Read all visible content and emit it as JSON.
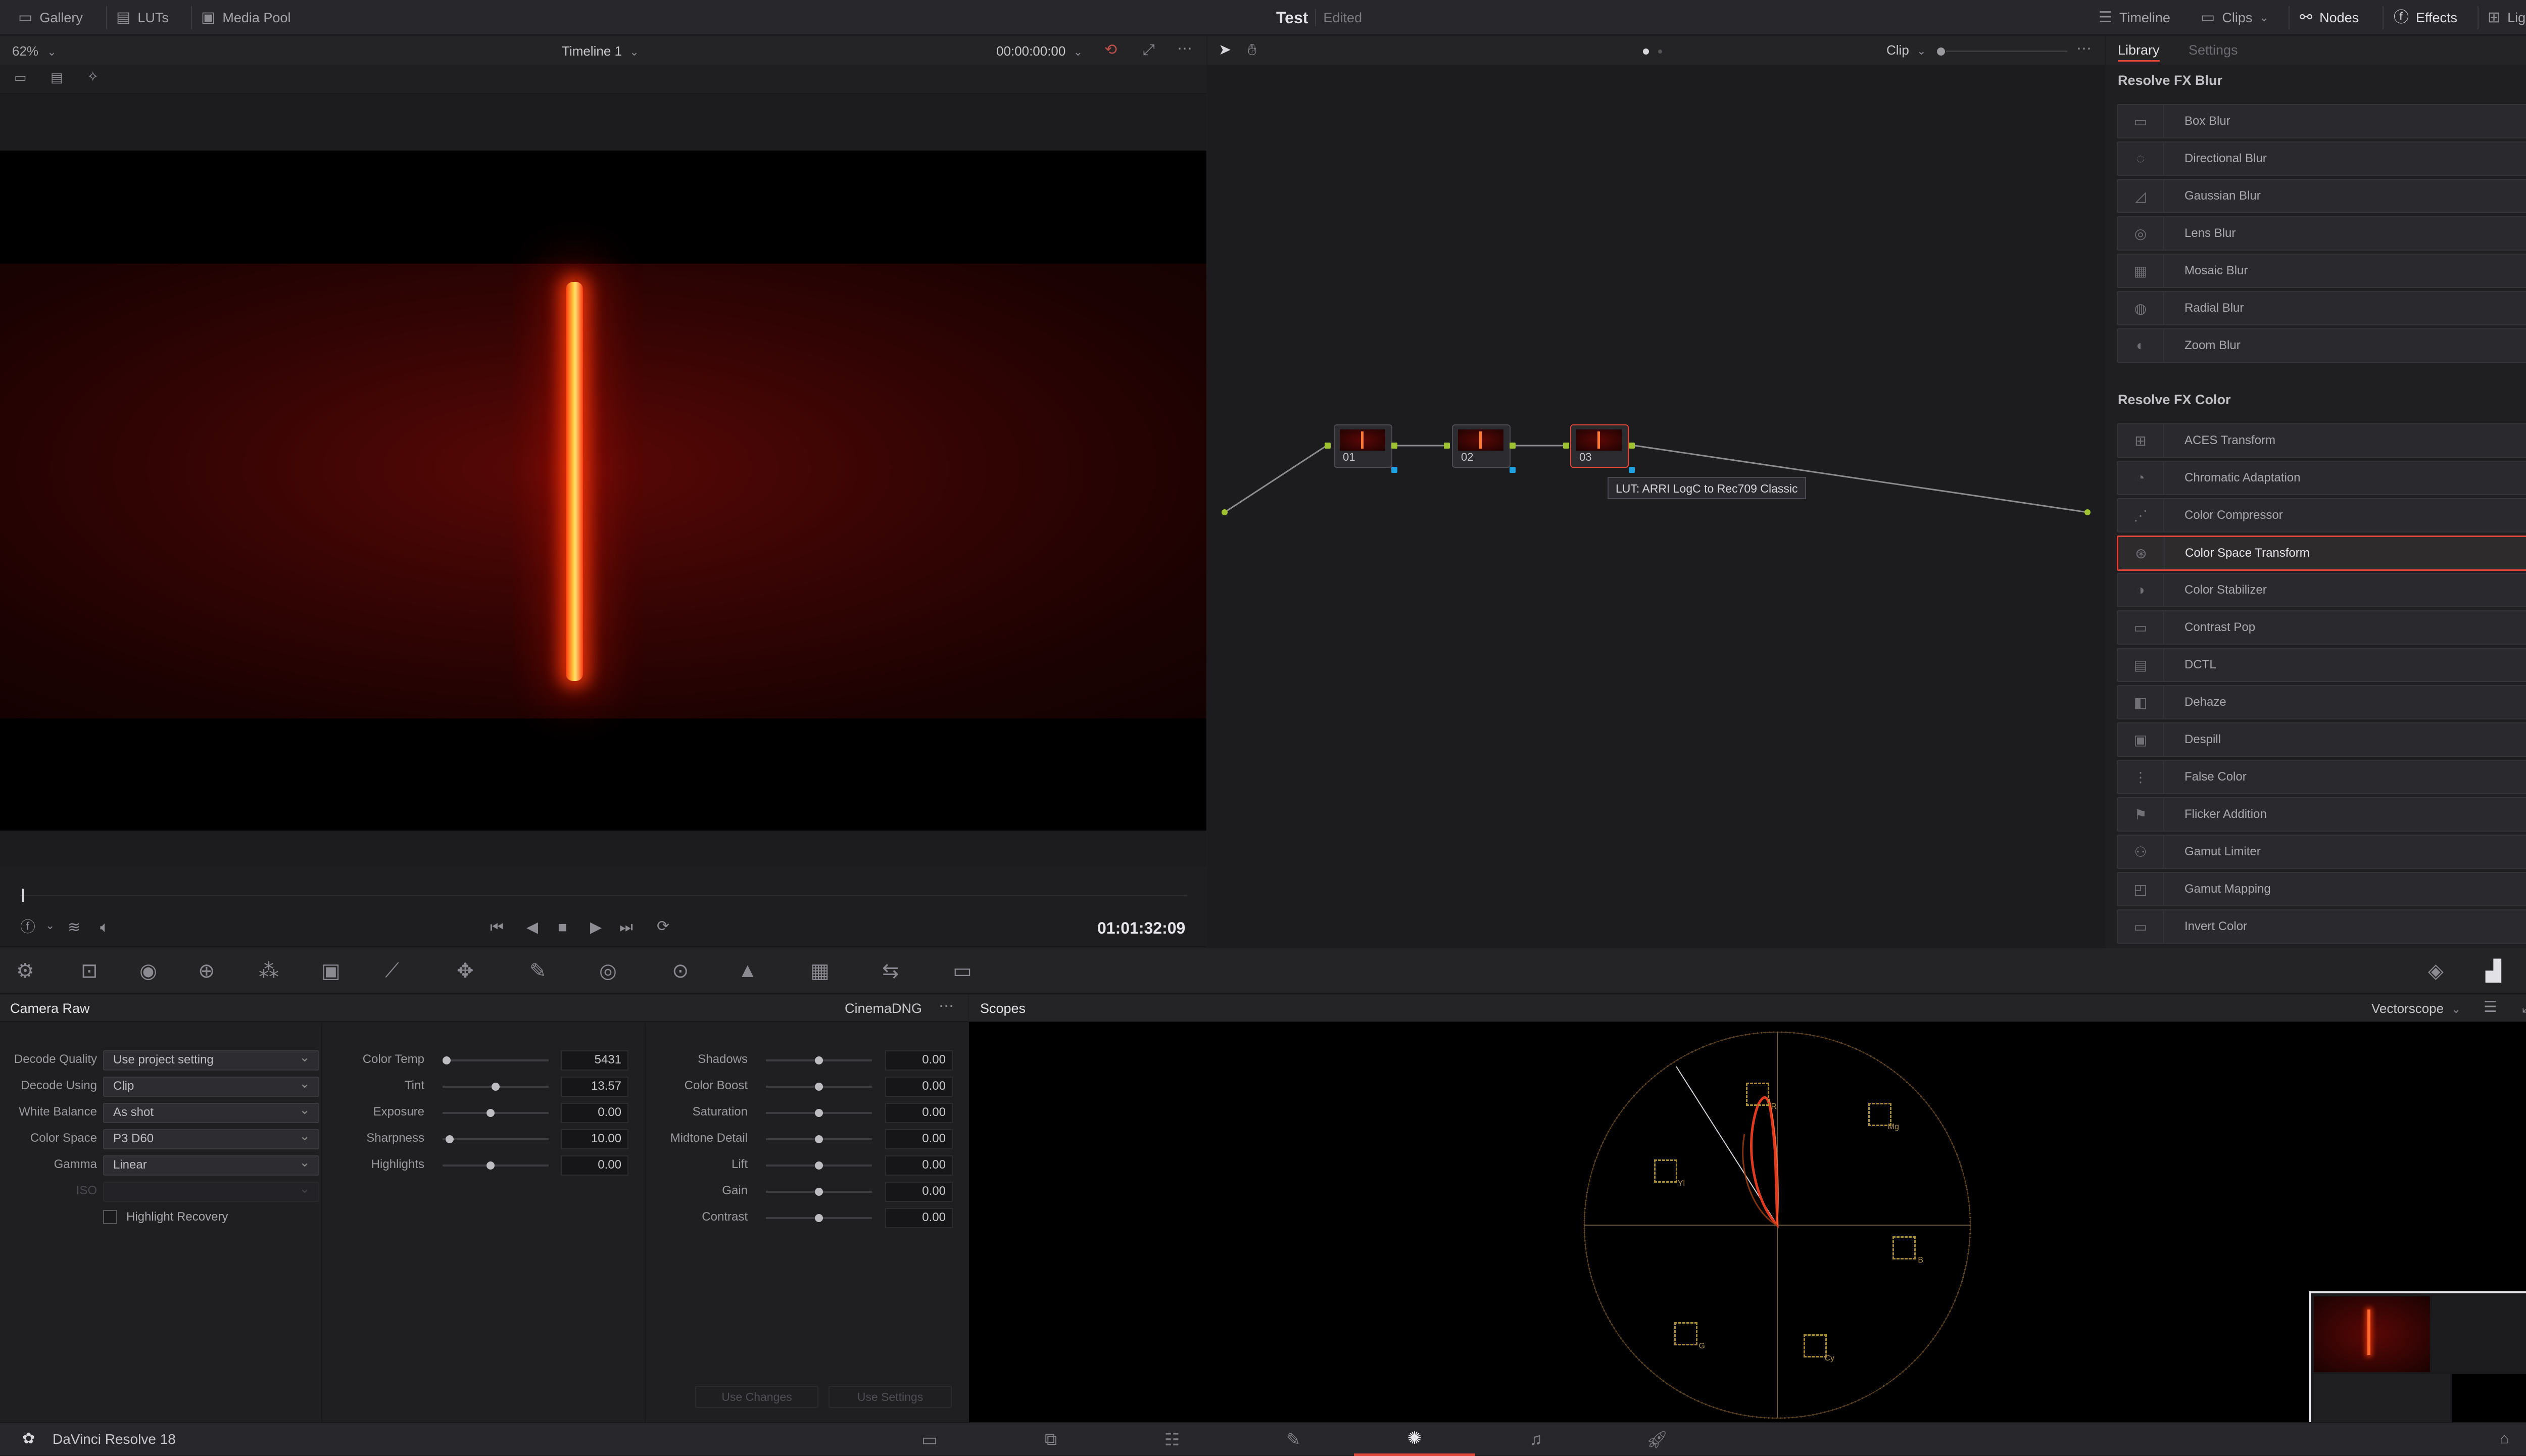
{
  "topbar": {
    "left": [
      {
        "icon": "gallery-icon",
        "label": "Gallery"
      },
      {
        "icon": "luts-icon",
        "label": "LUTs"
      },
      {
        "icon": "media-pool-icon",
        "label": "Media Pool"
      }
    ],
    "project": "Test",
    "status": "Edited",
    "right": [
      {
        "icon": "timeline-icon",
        "label": "Timeline"
      },
      {
        "icon": "clips-icon",
        "label": "Clips"
      },
      {
        "icon": "nodes-icon",
        "label": "Nodes"
      },
      {
        "icon": "effects-icon",
        "label": "Effects"
      },
      {
        "icon": "lightbox-icon",
        "label": "Lightbox"
      }
    ]
  },
  "viewer": {
    "zoom": "62%",
    "timeline_name": "Timeline 1",
    "timecode_top": "00:00:00:00",
    "timecode": "01:01:32:09"
  },
  "nodes_panel": {
    "mode": "Clip",
    "nodes": [
      {
        "label": "01"
      },
      {
        "label": "02"
      },
      {
        "label": "03"
      }
    ],
    "tooltip": "LUT: ARRI LogC to Rec709 Classic"
  },
  "library": {
    "tabs": [
      "Library",
      "Settings"
    ],
    "sections": [
      {
        "title": "Resolve FX Blur",
        "items": [
          "Box Blur",
          "Directional Blur",
          "Gaussian Blur",
          "Lens Blur",
          "Mosaic Blur",
          "Radial Blur",
          "Zoom Blur"
        ]
      },
      {
        "title": "Resolve FX Color",
        "items": [
          "ACES Transform",
          "Chromatic Adaptation",
          "Color Compressor",
          "Color Space Transform",
          "Color Stabilizer",
          "Contrast Pop",
          "DCTL",
          "Dehaze",
          "Despill",
          "False Color",
          "Flicker Addition",
          "Gamut Limiter",
          "Gamut Mapping",
          "Invert Color"
        ]
      }
    ],
    "selected": "Color Space Transform"
  },
  "camera_raw": {
    "title": "Camera Raw",
    "format": "CinemaDNG",
    "fields": [
      {
        "label": "Decode Quality",
        "value": "Use project setting"
      },
      {
        "label": "Decode Using",
        "value": "Clip"
      },
      {
        "label": "White Balance",
        "value": "As shot"
      },
      {
        "label": "Color Space",
        "value": "P3 D60"
      },
      {
        "label": "Gamma",
        "value": "Linear"
      },
      {
        "label": "ISO",
        "value": ""
      }
    ],
    "highlight_recovery": "Highlight Recovery",
    "sliders_mid": [
      {
        "label": "Color Temp",
        "value": "5431",
        "pos": 0.0
      },
      {
        "label": "Tint",
        "value": "13.57",
        "pos": 0.5
      },
      {
        "label": "Exposure",
        "value": "0.00",
        "pos": 0.45
      },
      {
        "label": "Sharpness",
        "value": "10.00",
        "pos": 0.03
      },
      {
        "label": "Highlights",
        "value": "0.00",
        "pos": 0.45
      }
    ],
    "sliders_right": [
      {
        "label": "Shadows",
        "value": "0.00"
      },
      {
        "label": "Color Boost",
        "value": "0.00"
      },
      {
        "label": "Saturation",
        "value": "0.00"
      },
      {
        "label": "Midtone Detail",
        "value": "0.00"
      },
      {
        "label": "Lift",
        "value": "0.00"
      },
      {
        "label": "Gain",
        "value": "0.00"
      },
      {
        "label": "Contrast",
        "value": "0.00"
      }
    ],
    "use_changes": "Use Changes",
    "use_settings": "Use Settings"
  },
  "scopes": {
    "title": "Scopes",
    "mode": "Vectorscope",
    "targets": [
      "R",
      "Mg",
      "B",
      "Cy",
      "G",
      "Yl"
    ]
  },
  "footer": {
    "app": "DaVinci Resolve 18"
  },
  "colors": {
    "accent": "#e0453a",
    "node_link": "#9fc233"
  }
}
